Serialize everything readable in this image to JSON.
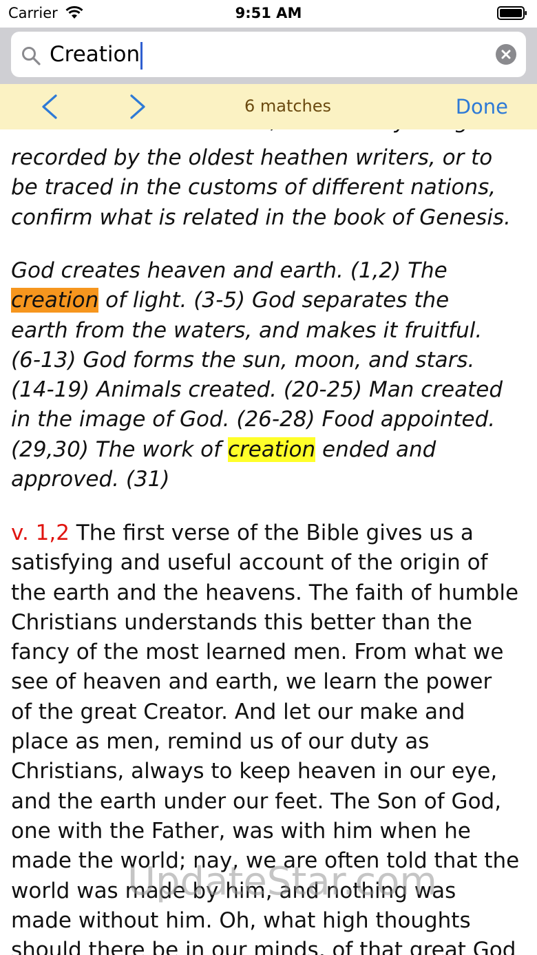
{
  "status": {
    "carrier": "Carrier",
    "time": "9:51 AM"
  },
  "search": {
    "value": "Creation"
  },
  "find": {
    "matches": "6 matches",
    "done_label": "Done"
  },
  "content": {
    "cut_line": "exists that contradicts it, while many things",
    "p1": [
      "recorded by the oldest heathen writers, or to",
      "be traced in the customs of different nations,",
      "confirm what is related in the book of Genesis."
    ],
    "p2": {
      "l1": "God creates heaven and earth. (1,2) The",
      "l2_hl": "creation",
      "l2_rest": " of light. (3-5) God separates the",
      "l3": "earth from the waters, and makes it fruitful.",
      "l4": "(6-13) God forms the sun, moon, and stars.",
      "l5": "(14-19) Animals created. (20-25) Man created",
      "l6": "in the image of God. (26-28) Food appointed.",
      "l7_pre": "(29,30) The work of ",
      "l7_hl": "creation",
      "l7_post": " ended and",
      "l8": "approved. (31)"
    },
    "p3": {
      "verse_ref": "v. 1,2",
      "l1_rest": "  The first verse of the Bible gives us a",
      "lines": [
        "satisfying and useful account of the origin of",
        "the earth and the heavens. The faith of humble",
        "Christians understands this better than the",
        "fancy of the most learned men. From what we",
        "see of heaven and earth, we learn the power",
        "of the great Creator. And let our make and",
        "place as men, remind us of our duty as",
        "Christians, always to keep heaven in our eye,",
        "and the earth under our feet. The Son of God,",
        "one with the Father, was with him when he",
        "made the world; nay, we are often told that the",
        "world was made by him, and nothing was",
        "made without him. Oh, what high thoughts",
        "should there be in our minds, of that great God"
      ]
    }
  },
  "watermark": "UpdateStar.com",
  "colors": {
    "current_match": "#f6961e",
    "match": "#ffff2a",
    "find_bar": "#fbf2c3",
    "accent": "#2e7ad6",
    "verse_ref": "#e0140f"
  }
}
